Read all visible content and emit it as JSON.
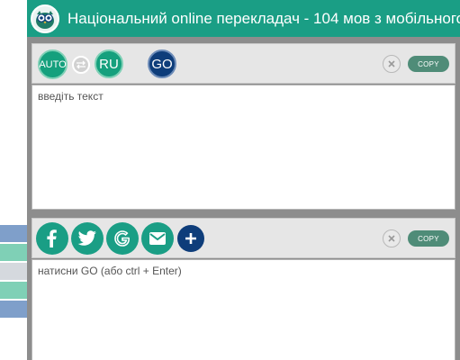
{
  "header": {
    "title": "Національний online перекладач - 104 мов з мобільного",
    "logo": "owl-logo"
  },
  "source": {
    "auto_label": "AUTO",
    "swap_icon": "swap-icon",
    "target_lang": "RU",
    "go_label": "GO",
    "copy_label": "COPY",
    "placeholder": "введіть текст"
  },
  "result": {
    "share_icons": [
      "facebook-icon",
      "twitter-icon",
      "google-icon",
      "mail-icon",
      "plus-icon"
    ],
    "copy_label": "COPY",
    "placeholder": "натисни GO (або ctrl + Enter)"
  },
  "colors": {
    "header": "#1a9e85",
    "accent_green": "#15a07d",
    "accent_blue": "#0e3d7a",
    "copy_button": "#4f8c78",
    "left_strips": [
      "#7f9fca",
      "#7fd0b6",
      "#d5d9de",
      "#7fd0b6",
      "#7f9fca"
    ]
  }
}
